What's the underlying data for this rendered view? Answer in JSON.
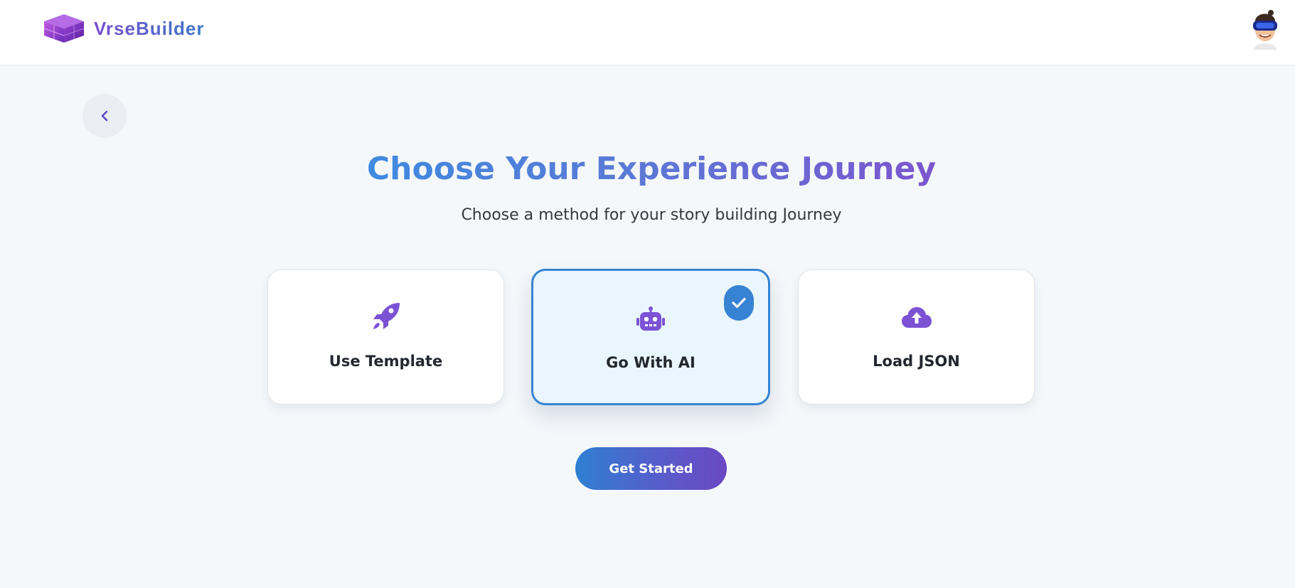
{
  "app": {
    "name": "VrseBuilder"
  },
  "header": {
    "logo_icon": "purple-cube-logo-icon",
    "avatar_icon": "vr-headset-avatar-icon"
  },
  "nav": {
    "back_icon": "chevron-left-icon"
  },
  "page": {
    "title": "Choose Your Experience Journey",
    "subtitle": "Choose a method for your story building Journey"
  },
  "options": [
    {
      "label": "Use Template",
      "icon": "rocket-icon",
      "selected": false
    },
    {
      "label": "Go With AI",
      "icon": "robot-icon",
      "selected": true
    },
    {
      "label": "Load JSON",
      "icon": "cloud-upload-icon",
      "selected": false
    }
  ],
  "cta": {
    "label": "Get Started"
  },
  "colors": {
    "accent_blue": "#3783d3",
    "accent_purple": "#7b55cf",
    "selected_card_bg": "#eaf6fd",
    "icon_purple": "#7b52d4"
  }
}
